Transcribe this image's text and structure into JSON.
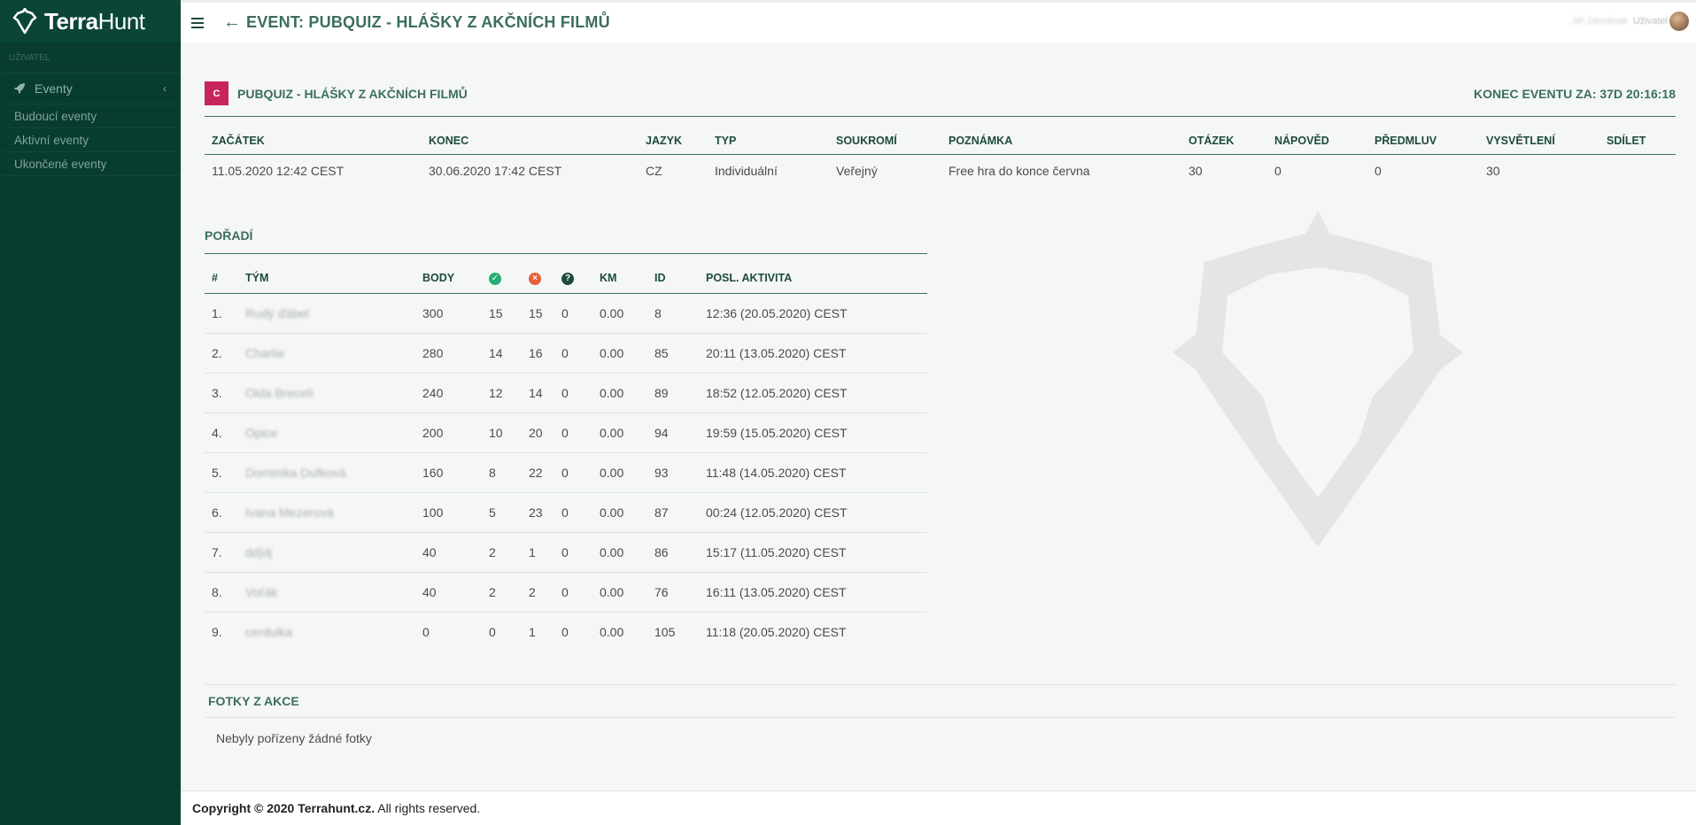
{
  "app": {
    "brand_bold": "Terra",
    "brand_light": "Hunt",
    "page_title": "EVENT: PUBQUIZ - HLÁŠKY Z AKČNÍCH FILMŮ",
    "user_name": "Jiří Zemánek",
    "user_role": "Uživatel"
  },
  "sidebar": {
    "section_label": "UŽIVATEL",
    "menu_label": "Eventy",
    "items": [
      {
        "label": "Budoucí eventy"
      },
      {
        "label": "Aktivní eventy"
      },
      {
        "label": "Ukončené eventy"
      }
    ]
  },
  "event": {
    "badge": "C",
    "name": "PUBQUIZ - HLÁŠKY Z AKČNÍCH FILMŮ",
    "end_countdown": "KONEC EVENTU ZA: 37D 20:16:18",
    "columns": [
      "ZAČÁTEK",
      "KONEC",
      "JAZYK",
      "TYP",
      "SOUKROMÍ",
      "POZNÁMKA",
      "OTÁZEK",
      "NÁPOVĚD",
      "PŘEDMLUV",
      "VYSVĚTLENÍ",
      "SDÍLET"
    ],
    "values": [
      "11.05.2020 12:42 CEST",
      "30.06.2020 17:42 CEST",
      "CZ",
      "Individuální",
      "Veřejný",
      "Free hra do konce června",
      "30",
      "0",
      "0",
      "30",
      ""
    ]
  },
  "ranking": {
    "title": "POŘADÍ",
    "columns": {
      "rank": "#",
      "team": "TÝM",
      "points": "BODY",
      "km": "KM",
      "id": "ID",
      "last_activity": "POSL. AKTIVITA"
    },
    "icons": {
      "correct": "check-circle-icon",
      "wrong": "x-circle-icon",
      "hint": "question-circle-icon"
    },
    "rows": [
      {
        "rank": "1.",
        "team": "Rudý ďábel",
        "points": "300",
        "correct": "15",
        "wrong": "15",
        "hints": "0",
        "km": "0.00",
        "id": "8",
        "last": "12:36 (20.05.2020) CEST"
      },
      {
        "rank": "2.",
        "team": "Charlie",
        "points": "280",
        "correct": "14",
        "wrong": "16",
        "hints": "0",
        "km": "0.00",
        "id": "85",
        "last": "20:11 (13.05.2020) CEST"
      },
      {
        "rank": "3.",
        "team": "Olda Brecelí",
        "points": "240",
        "correct": "12",
        "wrong": "14",
        "hints": "0",
        "km": "0.00",
        "id": "89",
        "last": "18:52 (12.05.2020) CEST"
      },
      {
        "rank": "4.",
        "team": "Opice",
        "points": "200",
        "correct": "10",
        "wrong": "20",
        "hints": "0",
        "km": "0.00",
        "id": "94",
        "last": "19:59 (15.05.2020) CEST"
      },
      {
        "rank": "5.",
        "team": "Dominika Dufková",
        "points": "160",
        "correct": "8",
        "wrong": "22",
        "hints": "0",
        "km": "0.00",
        "id": "93",
        "last": "11:48 (14.05.2020) CEST"
      },
      {
        "rank": "6.",
        "team": "Ivana Mezerová",
        "points": "100",
        "correct": "5",
        "wrong": "23",
        "hints": "0",
        "km": "0.00",
        "id": "87",
        "last": "00:24 (12.05.2020) CEST"
      },
      {
        "rank": "7.",
        "team": "dd|dj",
        "points": "40",
        "correct": "2",
        "wrong": "1",
        "hints": "0",
        "km": "0.00",
        "id": "86",
        "last": "15:17 (11.05.2020) CEST"
      },
      {
        "rank": "8.",
        "team": "Voťák",
        "points": "40",
        "correct": "2",
        "wrong": "2",
        "hints": "0",
        "km": "0.00",
        "id": "76",
        "last": "16:11 (13.05.2020) CEST"
      },
      {
        "rank": "9.",
        "team": "cerdulka",
        "points": "0",
        "correct": "0",
        "wrong": "1",
        "hints": "0",
        "km": "0.00",
        "id": "105",
        "last": "11:18 (20.05.2020) CEST"
      }
    ]
  },
  "photos": {
    "title": "FOTKY Z AKCE",
    "empty_text": "Nebyly pořízeny žádné fotky"
  },
  "footer": {
    "copyright": "Copyright © 2020 Terrahunt.cz.",
    "rights": " All rights reserved."
  }
}
